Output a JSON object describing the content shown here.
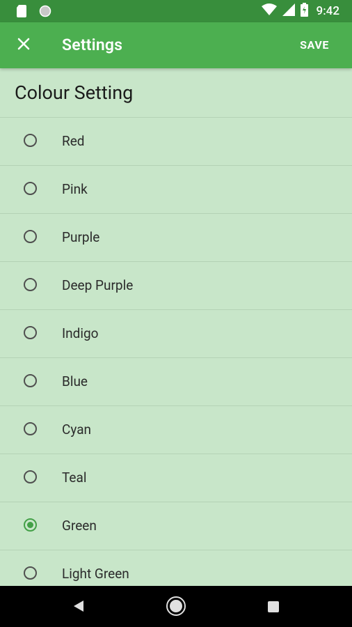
{
  "status": {
    "time": "9:42",
    "icons": [
      "sd-card-icon",
      "sync-circle-icon",
      "wifi-icon",
      "signal-icon",
      "battery-icon"
    ]
  },
  "appbar": {
    "title": "Settings",
    "save_label": "SAVE",
    "close_icon": "close-icon"
  },
  "section": {
    "title": "Colour Setting"
  },
  "options": [
    {
      "label": "Red",
      "checked": false
    },
    {
      "label": "Pink",
      "checked": false
    },
    {
      "label": "Purple",
      "checked": false
    },
    {
      "label": "Deep Purple",
      "checked": false
    },
    {
      "label": "Indigo",
      "checked": false
    },
    {
      "label": "Blue",
      "checked": false
    },
    {
      "label": "Cyan",
      "checked": false
    },
    {
      "label": "Teal",
      "checked": false
    },
    {
      "label": "Green",
      "checked": true
    },
    {
      "label": "Light Green",
      "checked": false
    }
  ],
  "colors": {
    "status_bar": "#388e3c",
    "app_bar": "#4caf50",
    "background": "#c8e6c9",
    "accent": "#43a047"
  },
  "navbar": {
    "icons": [
      "back-icon",
      "home-icon",
      "recents-icon"
    ]
  }
}
